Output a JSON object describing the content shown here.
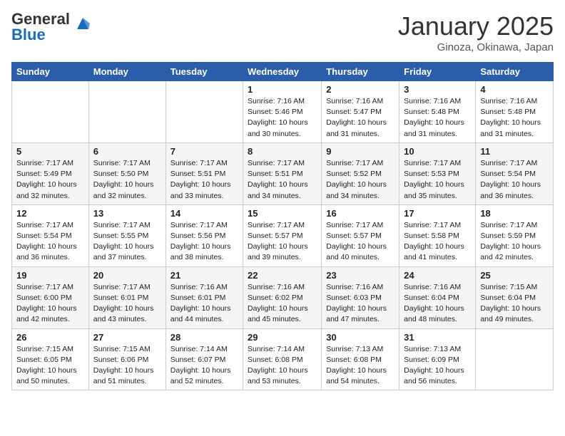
{
  "header": {
    "logo_general": "General",
    "logo_blue": "Blue",
    "month": "January 2025",
    "location": "Ginoza, Okinawa, Japan"
  },
  "days_of_week": [
    "Sunday",
    "Monday",
    "Tuesday",
    "Wednesday",
    "Thursday",
    "Friday",
    "Saturday"
  ],
  "weeks": [
    [
      {
        "day": "",
        "info": ""
      },
      {
        "day": "",
        "info": ""
      },
      {
        "day": "",
        "info": ""
      },
      {
        "day": "1",
        "info": "Sunrise: 7:16 AM\nSunset: 5:46 PM\nDaylight: 10 hours\nand 30 minutes."
      },
      {
        "day": "2",
        "info": "Sunrise: 7:16 AM\nSunset: 5:47 PM\nDaylight: 10 hours\nand 31 minutes."
      },
      {
        "day": "3",
        "info": "Sunrise: 7:16 AM\nSunset: 5:48 PM\nDaylight: 10 hours\nand 31 minutes."
      },
      {
        "day": "4",
        "info": "Sunrise: 7:16 AM\nSunset: 5:48 PM\nDaylight: 10 hours\nand 31 minutes."
      }
    ],
    [
      {
        "day": "5",
        "info": "Sunrise: 7:17 AM\nSunset: 5:49 PM\nDaylight: 10 hours\nand 32 minutes."
      },
      {
        "day": "6",
        "info": "Sunrise: 7:17 AM\nSunset: 5:50 PM\nDaylight: 10 hours\nand 32 minutes."
      },
      {
        "day": "7",
        "info": "Sunrise: 7:17 AM\nSunset: 5:51 PM\nDaylight: 10 hours\nand 33 minutes."
      },
      {
        "day": "8",
        "info": "Sunrise: 7:17 AM\nSunset: 5:51 PM\nDaylight: 10 hours\nand 34 minutes."
      },
      {
        "day": "9",
        "info": "Sunrise: 7:17 AM\nSunset: 5:52 PM\nDaylight: 10 hours\nand 34 minutes."
      },
      {
        "day": "10",
        "info": "Sunrise: 7:17 AM\nSunset: 5:53 PM\nDaylight: 10 hours\nand 35 minutes."
      },
      {
        "day": "11",
        "info": "Sunrise: 7:17 AM\nSunset: 5:54 PM\nDaylight: 10 hours\nand 36 minutes."
      }
    ],
    [
      {
        "day": "12",
        "info": "Sunrise: 7:17 AM\nSunset: 5:54 PM\nDaylight: 10 hours\nand 36 minutes."
      },
      {
        "day": "13",
        "info": "Sunrise: 7:17 AM\nSunset: 5:55 PM\nDaylight: 10 hours\nand 37 minutes."
      },
      {
        "day": "14",
        "info": "Sunrise: 7:17 AM\nSunset: 5:56 PM\nDaylight: 10 hours\nand 38 minutes."
      },
      {
        "day": "15",
        "info": "Sunrise: 7:17 AM\nSunset: 5:57 PM\nDaylight: 10 hours\nand 39 minutes."
      },
      {
        "day": "16",
        "info": "Sunrise: 7:17 AM\nSunset: 5:57 PM\nDaylight: 10 hours\nand 40 minutes."
      },
      {
        "day": "17",
        "info": "Sunrise: 7:17 AM\nSunset: 5:58 PM\nDaylight: 10 hours\nand 41 minutes."
      },
      {
        "day": "18",
        "info": "Sunrise: 7:17 AM\nSunset: 5:59 PM\nDaylight: 10 hours\nand 42 minutes."
      }
    ],
    [
      {
        "day": "19",
        "info": "Sunrise: 7:17 AM\nSunset: 6:00 PM\nDaylight: 10 hours\nand 42 minutes."
      },
      {
        "day": "20",
        "info": "Sunrise: 7:17 AM\nSunset: 6:01 PM\nDaylight: 10 hours\nand 43 minutes."
      },
      {
        "day": "21",
        "info": "Sunrise: 7:16 AM\nSunset: 6:01 PM\nDaylight: 10 hours\nand 44 minutes."
      },
      {
        "day": "22",
        "info": "Sunrise: 7:16 AM\nSunset: 6:02 PM\nDaylight: 10 hours\nand 45 minutes."
      },
      {
        "day": "23",
        "info": "Sunrise: 7:16 AM\nSunset: 6:03 PM\nDaylight: 10 hours\nand 47 minutes."
      },
      {
        "day": "24",
        "info": "Sunrise: 7:16 AM\nSunset: 6:04 PM\nDaylight: 10 hours\nand 48 minutes."
      },
      {
        "day": "25",
        "info": "Sunrise: 7:15 AM\nSunset: 6:04 PM\nDaylight: 10 hours\nand 49 minutes."
      }
    ],
    [
      {
        "day": "26",
        "info": "Sunrise: 7:15 AM\nSunset: 6:05 PM\nDaylight: 10 hours\nand 50 minutes."
      },
      {
        "day": "27",
        "info": "Sunrise: 7:15 AM\nSunset: 6:06 PM\nDaylight: 10 hours\nand 51 minutes."
      },
      {
        "day": "28",
        "info": "Sunrise: 7:14 AM\nSunset: 6:07 PM\nDaylight: 10 hours\nand 52 minutes."
      },
      {
        "day": "29",
        "info": "Sunrise: 7:14 AM\nSunset: 6:08 PM\nDaylight: 10 hours\nand 53 minutes."
      },
      {
        "day": "30",
        "info": "Sunrise: 7:13 AM\nSunset: 6:08 PM\nDaylight: 10 hours\nand 54 minutes."
      },
      {
        "day": "31",
        "info": "Sunrise: 7:13 AM\nSunset: 6:09 PM\nDaylight: 10 hours\nand 56 minutes."
      },
      {
        "day": "",
        "info": ""
      }
    ]
  ]
}
